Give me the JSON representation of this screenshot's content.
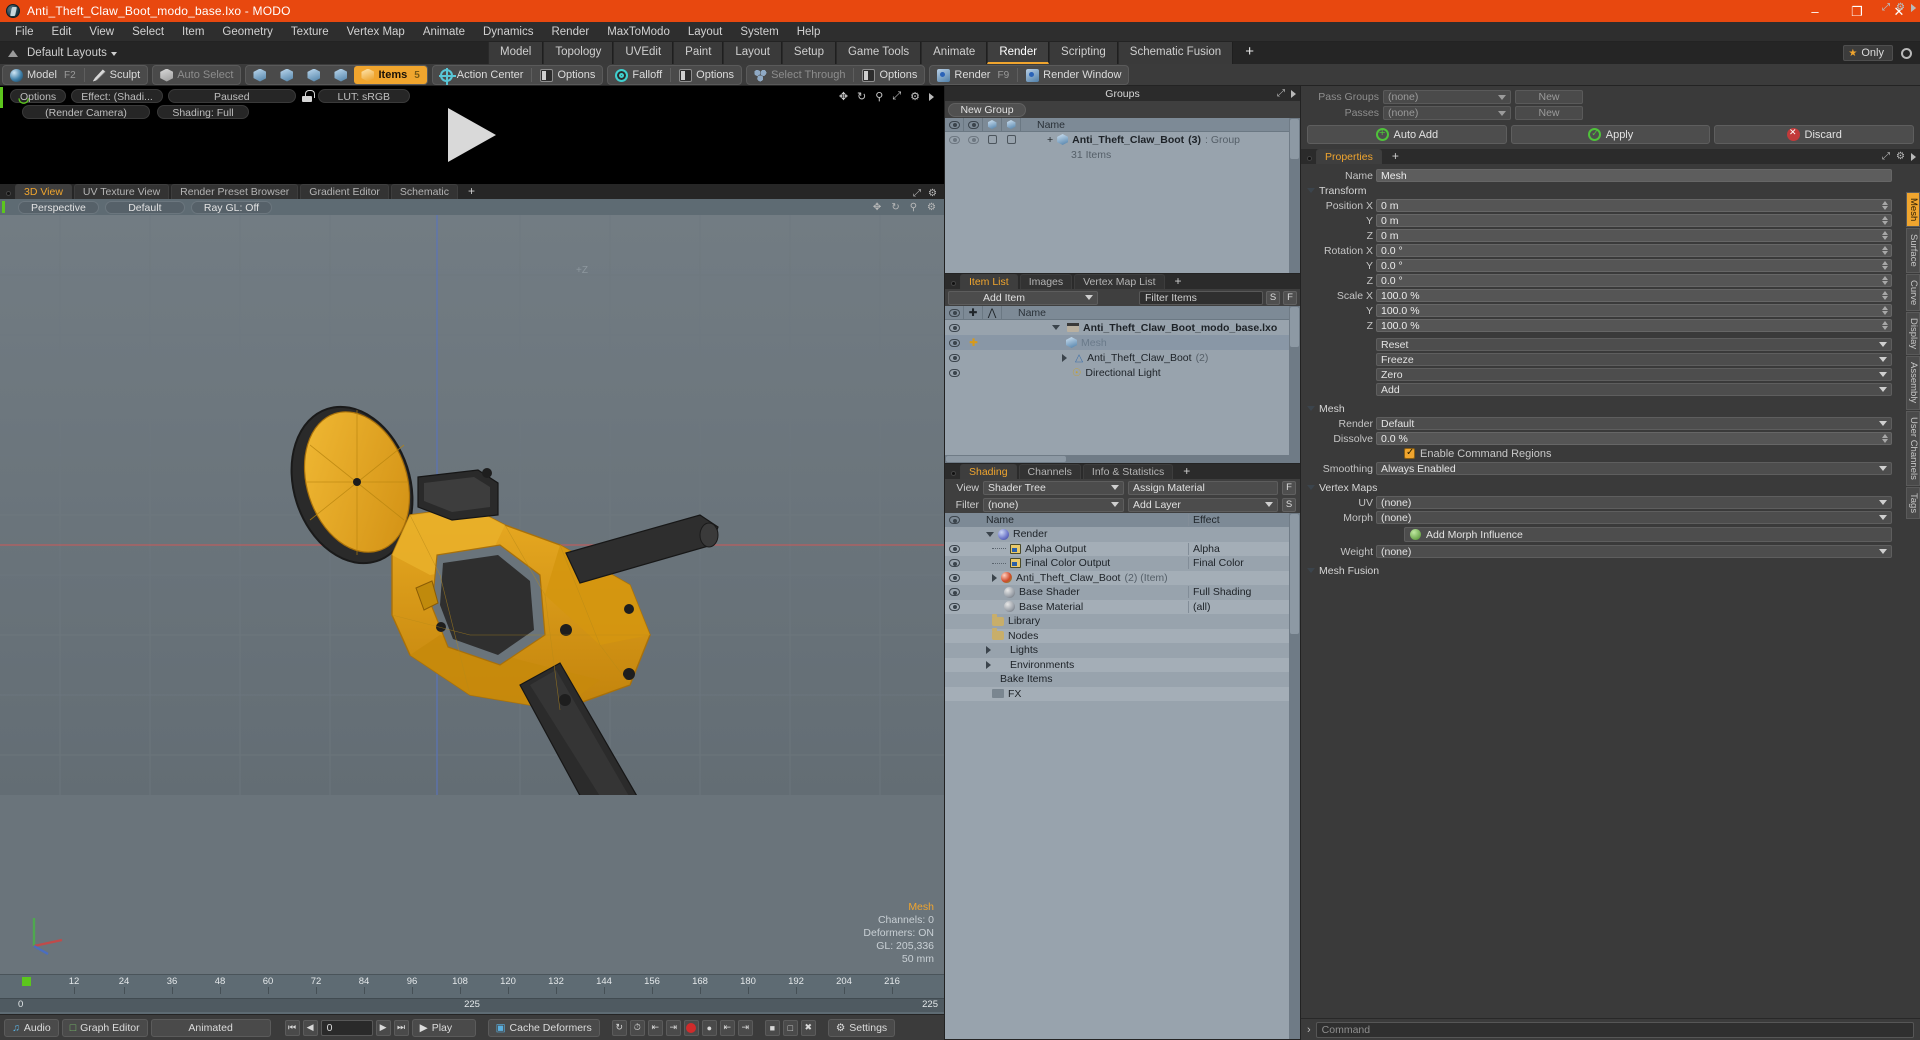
{
  "window": {
    "title": "Anti_Theft_Claw_Boot_modo_base.lxo - MODO",
    "minimize": "–",
    "maximize": "❐",
    "close": "✕"
  },
  "menubar": [
    "File",
    "Edit",
    "View",
    "Select",
    "Item",
    "Geometry",
    "Texture",
    "Vertex Map",
    "Animate",
    "Dynamics",
    "Render",
    "MaxToModo",
    "Layout",
    "System",
    "Help"
  ],
  "layoutbar": {
    "preset": "Default Layouts",
    "tabs": [
      "Model",
      "Topology",
      "UVEdit",
      "Paint",
      "Layout",
      "Setup",
      "Game Tools",
      "Animate",
      "Render",
      "Scripting",
      "Schematic Fusion"
    ],
    "active_tab": "Render",
    "add_tab": "+",
    "only_label": "Only"
  },
  "toolbar": {
    "mode_model": "Model",
    "mode_model_key": "F2",
    "mode_sculpt": "Sculpt",
    "auto_select": "Auto Select",
    "items": "Items",
    "items_key": "5",
    "action_center": "Action Center",
    "options1": "Options",
    "falloff": "Falloff",
    "options2": "Options",
    "select_through": "Select Through",
    "options3": "Options",
    "render": "Render",
    "render_key": "F9",
    "render_window": "Render Window"
  },
  "preview": {
    "options": "Options",
    "effect": "Effect: (Shadi...",
    "status": "Paused",
    "lut": "LUT: sRGB",
    "camera": "(Render Camera)",
    "shading": "Shading: Full"
  },
  "viewport": {
    "tabs": [
      "3D View",
      "UV Texture View",
      "Render Preset Browser",
      "Gradient Editor",
      "Schematic"
    ],
    "active_tab": "3D View",
    "add_tab": "+",
    "projection": "Perspective",
    "shading_preset": "Default",
    "ray_gl": "Ray GL: Off",
    "axis_label": "+Z",
    "stats": {
      "name": "Mesh",
      "channels": "Channels: 0",
      "deformers": "Deformers: ON",
      "gl": "GL: 205,336",
      "scale": "50 mm"
    }
  },
  "timeline": {
    "ticks": [
      "12",
      "24",
      "36",
      "48",
      "60",
      "72",
      "84",
      "96",
      "108",
      "120",
      "132",
      "144",
      "156",
      "168",
      "180",
      "192",
      "204",
      "216"
    ],
    "start": "0",
    "mid": "225",
    "end": "225"
  },
  "statusbar": {
    "audio": "Audio",
    "graph_editor": "Graph Editor",
    "animated": "Animated",
    "frame_value": "0",
    "play": "Play",
    "cache_deformers": "Cache Deformers",
    "settings": "Settings"
  },
  "groups_panel": {
    "title": "Groups",
    "new_group": "New Group",
    "columns": [
      "Name"
    ],
    "rows": [
      {
        "name": "Anti_Theft_Claw_Boot",
        "count": "(3)",
        "type": ": Group",
        "sub": "31 Items"
      }
    ]
  },
  "item_list_panel": {
    "tabs": [
      "Item List",
      "Images",
      "Vertex Map List"
    ],
    "active_tab": "Item List",
    "add_tab": "+",
    "add_item": "Add Item",
    "filter_placeholder": "Filter Items",
    "btn_s": "S",
    "btn_f": "F",
    "columns": [
      "Name"
    ],
    "rows": [
      {
        "name": "Anti_Theft_Claw_Boot_modo_base.lxo",
        "meta": "",
        "indent": 0,
        "bold": true,
        "selected": false
      },
      {
        "name": "Mesh",
        "meta": "",
        "indent": 1,
        "bold": false,
        "selected": true
      },
      {
        "name": "Anti_Theft_Claw_Boot",
        "meta": "(2)",
        "indent": 1,
        "bold": false,
        "selected": false
      },
      {
        "name": "Directional Light",
        "meta": "",
        "indent": 1,
        "bold": false,
        "selected": false
      }
    ]
  },
  "shading_panel": {
    "tabs": [
      "Shading",
      "Channels",
      "Info & Statistics"
    ],
    "active_tab": "Shading",
    "add_tab": "+",
    "view_label": "View",
    "view_value": "Shader Tree",
    "filter_label": "Filter",
    "filter_value": "(none)",
    "assign_material": "Assign Material",
    "add_layer": "Add Layer",
    "btn_f": "F",
    "btn_s": "S",
    "columns": {
      "name": "Name",
      "effect": "Effect"
    },
    "rows": [
      {
        "name": "Render",
        "meta": "",
        "effect": "",
        "indent": 0,
        "icon": "sphere-blue",
        "eye": false,
        "caret": "down"
      },
      {
        "name": "Alpha Output",
        "meta": "",
        "effect": "Alpha",
        "indent": 1,
        "icon": "image",
        "eye": true,
        "caret": ""
      },
      {
        "name": "Final Color Output",
        "meta": "",
        "effect": "Final Color",
        "indent": 1,
        "icon": "image",
        "eye": true,
        "caret": ""
      },
      {
        "name": "Anti_Theft_Claw_Boot",
        "meta": "(2) (Item)",
        "effect": "",
        "indent": 1,
        "icon": "sphere-red",
        "eye": true,
        "caret": "right"
      },
      {
        "name": "Base Shader",
        "meta": "",
        "effect": "Full Shading",
        "indent": 2,
        "icon": "sphere-gray",
        "eye": true,
        "caret": ""
      },
      {
        "name": "Base Material",
        "meta": "",
        "effect": "(all)",
        "indent": 2,
        "icon": "sphere-gray",
        "eye": true,
        "caret": ""
      },
      {
        "name": "Library",
        "meta": "",
        "effect": "",
        "indent": 1,
        "icon": "folder",
        "eye": false,
        "caret": ""
      },
      {
        "name": "Nodes",
        "meta": "",
        "effect": "",
        "indent": 1,
        "icon": "folder",
        "eye": false,
        "caret": ""
      },
      {
        "name": "Lights",
        "meta": "",
        "effect": "",
        "indent": 0,
        "icon": "none",
        "eye": false,
        "caret": "right"
      },
      {
        "name": "Environments",
        "meta": "",
        "effect": "",
        "indent": 0,
        "icon": "none",
        "eye": false,
        "caret": "right"
      },
      {
        "name": "Bake Items",
        "meta": "",
        "effect": "",
        "indent": 0,
        "icon": "none",
        "eye": false,
        "caret": ""
      },
      {
        "name": "FX",
        "meta": "",
        "effect": "",
        "indent": 0,
        "icon": "fx",
        "eye": false,
        "caret": ""
      }
    ]
  },
  "passes_panel": {
    "pass_groups_label": "Pass Groups",
    "pass_groups_value": "(none)",
    "passes_label": "Passes",
    "passes_value": "(none)",
    "new_button": "New",
    "new_button_2": "New",
    "auto_add": "Auto Add",
    "apply": "Apply",
    "discard": "Discard"
  },
  "properties_panel": {
    "tabs": [
      "Properties"
    ],
    "active_tab": "Properties",
    "add_tab": "+",
    "name_label": "Name",
    "name_value": "Mesh",
    "transform_header": "Transform",
    "transform": [
      {
        "label": "Position X",
        "value": "0 m"
      },
      {
        "label": "Y",
        "value": "0 m"
      },
      {
        "label": "Z",
        "value": "0 m"
      },
      {
        "label": "Rotation X",
        "value": "0.0 °"
      },
      {
        "label": "Y",
        "value": "0.0 °"
      },
      {
        "label": "Z",
        "value": "0.0 °"
      },
      {
        "label": "Scale X",
        "value": "100.0 %"
      },
      {
        "label": "Y",
        "value": "100.0 %"
      },
      {
        "label": "Z",
        "value": "100.0 %"
      }
    ],
    "transform_menus": [
      "Reset",
      "Freeze",
      "Zero",
      "Add"
    ],
    "mesh_header": "Mesh",
    "mesh": [
      {
        "label": "Render",
        "value": "Default",
        "type": "dropdown"
      },
      {
        "label": "Dissolve",
        "value": "0.0 %",
        "type": "field"
      },
      {
        "label": "",
        "value": "Enable Command Regions",
        "type": "checkbox"
      },
      {
        "label": "Smoothing",
        "value": "Always Enabled",
        "type": "dropdown"
      }
    ],
    "vertex_maps_header": "Vertex Maps",
    "vertex_maps": [
      {
        "label": "UV",
        "value": "(none)"
      },
      {
        "label": "Morph",
        "value": "(none)"
      },
      {
        "label": "Weight",
        "value": "(none)"
      }
    ],
    "add_morph_influence": "Add Morph Influence",
    "mesh_fusion_header": "Mesh Fusion",
    "side_tabs": [
      "Mesh",
      "Surface",
      "Curve",
      "Display",
      "Assembly",
      "User Channels",
      "Tags"
    ],
    "side_active": "Mesh"
  },
  "command_bar": {
    "prompt": "›",
    "placeholder": "Command"
  },
  "colors": {
    "title_bar": "#e8480f",
    "accent": "#f0a52e",
    "panel_bg": "#3a3a3a",
    "tree_bg": "#98a3ad",
    "viewport_bg": "#6a747b",
    "model_yellow": "#e0a521",
    "model_dark": "#2b2b2b"
  }
}
